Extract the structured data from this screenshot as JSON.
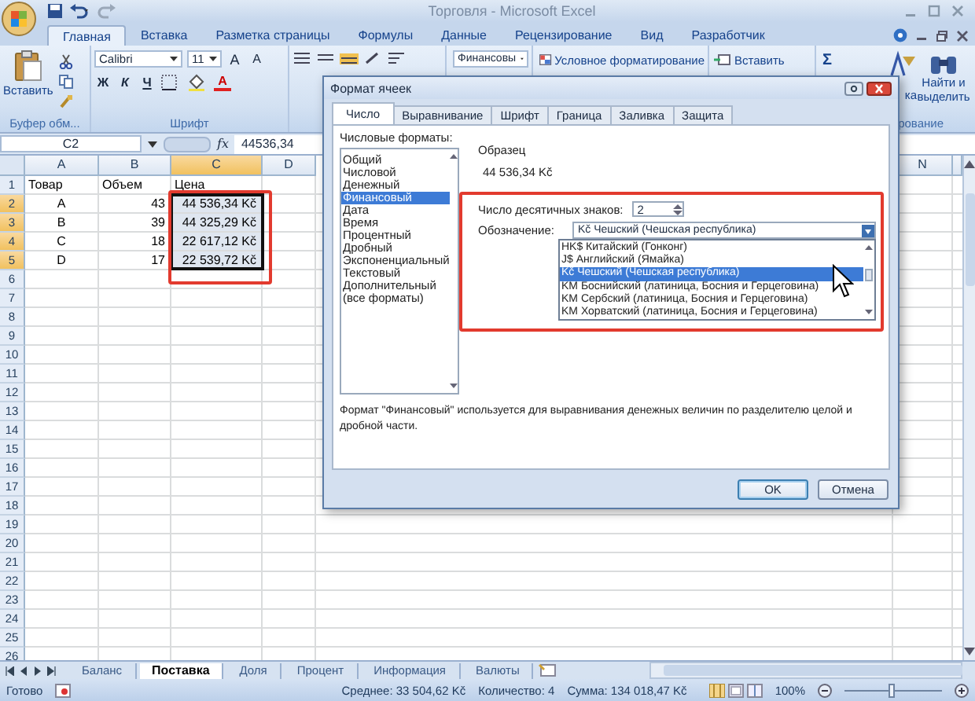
{
  "title_bar": {
    "title": "Торговля - Microsoft Excel"
  },
  "ribbon_tabs": [
    {
      "label": "Главная",
      "selected": true
    },
    {
      "label": "Вставка",
      "selected": false
    },
    {
      "label": "Разметка страницы",
      "selected": false
    },
    {
      "label": "Формулы",
      "selected": false
    },
    {
      "label": "Данные",
      "selected": false
    },
    {
      "label": "Рецензирование",
      "selected": false
    },
    {
      "label": "Вид",
      "selected": false
    },
    {
      "label": "Разработчик",
      "selected": false
    }
  ],
  "ribbon": {
    "clipboard": {
      "paste": "Вставить",
      "group": "Буфер обм..."
    },
    "font": {
      "name": "Calibri",
      "size": "11",
      "grow": "A",
      "shrink": "A",
      "bold": "Ж",
      "italic": "К",
      "underline": "Ч",
      "color_button": "A",
      "group": "Шрифт"
    },
    "number": {
      "format": "Финансовы"
    },
    "styles": {
      "conditional": "Условное форматирование"
    },
    "cells": {
      "insert": "Вставить"
    },
    "editing": {
      "sum": "Σ",
      "sort_fragment": "ка",
      "find": "Найти и выделить",
      "group_fragment": "рование"
    }
  },
  "formula_bar": {
    "name_box": "C2",
    "function_label": "fx",
    "value": "44536,34"
  },
  "sheet": {
    "columns": [
      {
        "label": "A",
        "selected": false
      },
      {
        "label": "B",
        "selected": false
      },
      {
        "label": "C",
        "selected": true
      },
      {
        "label": "D",
        "selected": false
      },
      {
        "label": "N",
        "selected": false
      }
    ],
    "rows": [
      {
        "header": "1",
        "selected": false,
        "cells": [
          "Товар",
          "Объем",
          "Цена"
        ]
      },
      {
        "header": "2",
        "selected": true,
        "cells": [
          "A",
          "43",
          "44 536,34 Kč"
        ]
      },
      {
        "header": "3",
        "selected": true,
        "cells": [
          "B",
          "39",
          "44 325,29 Kč"
        ]
      },
      {
        "header": "4",
        "selected": true,
        "cells": [
          "C",
          "18",
          "22 617,12 Kč"
        ]
      },
      {
        "header": "5",
        "selected": true,
        "cells": [
          "D",
          "17",
          "22 539,72 Kč"
        ]
      },
      {
        "header": "6",
        "selected": false,
        "cells": []
      },
      {
        "header": "7",
        "selected": false,
        "cells": []
      },
      {
        "header": "8",
        "selected": false,
        "cells": []
      },
      {
        "header": "9",
        "selected": false,
        "cells": []
      },
      {
        "header": "10",
        "selected": false,
        "cells": []
      },
      {
        "header": "11",
        "selected": false,
        "cells": []
      },
      {
        "header": "12",
        "selected": false,
        "cells": []
      },
      {
        "header": "13",
        "selected": false,
        "cells": []
      },
      {
        "header": "14",
        "selected": false,
        "cells": []
      },
      {
        "header": "15",
        "selected": false,
        "cells": []
      },
      {
        "header": "16",
        "selected": false,
        "cells": []
      },
      {
        "header": "17",
        "selected": false,
        "cells": []
      },
      {
        "header": "18",
        "selected": false,
        "cells": []
      },
      {
        "header": "19",
        "selected": false,
        "cells": []
      },
      {
        "header": "20",
        "selected": false,
        "cells": []
      },
      {
        "header": "21",
        "selected": false,
        "cells": []
      },
      {
        "header": "22",
        "selected": false,
        "cells": []
      },
      {
        "header": "23",
        "selected": false,
        "cells": []
      },
      {
        "header": "24",
        "selected": false,
        "cells": []
      },
      {
        "header": "25",
        "selected": false,
        "cells": []
      },
      {
        "header": "26",
        "selected": false,
        "cells": []
      }
    ]
  },
  "sheet_tabs": [
    {
      "label": "Баланс",
      "selected": false
    },
    {
      "label": "Поставка",
      "selected": true
    },
    {
      "label": "Доля",
      "selected": false
    },
    {
      "label": "Процент",
      "selected": false
    },
    {
      "label": "Информация",
      "selected": false
    },
    {
      "label": "Валюты",
      "selected": false
    }
  ],
  "status_bar": {
    "state": "Готово",
    "average": "Среднее: 33 504,62 Kč",
    "count": "Количество: 4",
    "sum": "Сумма: 134 018,47 Kč",
    "zoom": "100%",
    "zoom_slider": {
      "level": 0.5
    }
  },
  "dialog": {
    "title": "Формат ячеек",
    "tabs": [
      {
        "label": "Число",
        "selected": true
      },
      {
        "label": "Выравнивание",
        "selected": false
      },
      {
        "label": "Шрифт",
        "selected": false
      },
      {
        "label": "Граница",
        "selected": false
      },
      {
        "label": "Заливка",
        "selected": false
      },
      {
        "label": "Защита",
        "selected": false
      }
    ],
    "formats_label": "Числовые форматы:",
    "formats": [
      {
        "label": "Общий",
        "selected": false
      },
      {
        "label": "Числовой",
        "selected": false
      },
      {
        "label": "Денежный",
        "selected": false
      },
      {
        "label": "Финансовый",
        "selected": true
      },
      {
        "label": "Дата",
        "selected": false
      },
      {
        "label": "Время",
        "selected": false
      },
      {
        "label": "Процентный",
        "selected": false
      },
      {
        "label": "Дробный",
        "selected": false
      },
      {
        "label": "Экспоненциальный",
        "selected": false
      },
      {
        "label": "Текстовый",
        "selected": false
      },
      {
        "label": "Дополнительный",
        "selected": false
      },
      {
        "label": "(все форматы)",
        "selected": false
      }
    ],
    "sample_label": "Образец",
    "sample": "44 536,34 Kč",
    "decimals_label": "Число десятичных знаков:",
    "decimals": "2",
    "symbol_label": "Обозначение:",
    "symbol": "Kč Чешский (Чешская республика)",
    "symbol_options": [
      {
        "label": "HK$ Китайский (Гонконг)",
        "selected": false
      },
      {
        "label": "J$ Английский (Ямайка)",
        "selected": false
      },
      {
        "label": "Kč Чешский (Чешская республика)",
        "selected": true
      },
      {
        "label": "KM Боснийский (латиница, Босния и Герцеговина)",
        "selected": false
      },
      {
        "label": "KM Сербский (латиница, Босния и Герцеговина)",
        "selected": false
      },
      {
        "label": "KM Хорватский (латиница, Босния и Герцеговина)",
        "selected": false
      }
    ],
    "description": "Формат \"Финансовый\" используется для выравнивания денежных величин по разделителю целой и дробной части.",
    "buttons": [
      "OK",
      "Отмена"
    ]
  }
}
